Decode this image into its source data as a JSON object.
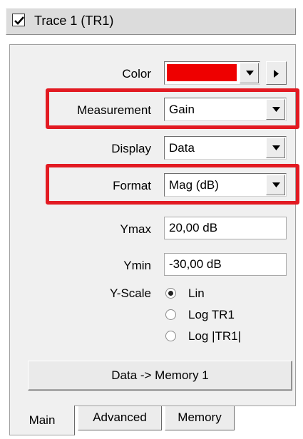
{
  "trace": {
    "title": "Trace 1 (TR1)",
    "enabled": true
  },
  "fields": {
    "color_label": "Color",
    "color_value": "#ee0000",
    "measurement_label": "Measurement",
    "measurement_value": "Gain",
    "display_label": "Display",
    "display_value": "Data",
    "format_label": "Format",
    "format_value": "Mag (dB)",
    "ymax_label": "Ymax",
    "ymax_value": "20,00 dB",
    "ymin_label": "Ymin",
    "ymin_value": "-30,00 dB"
  },
  "yscale": {
    "label": "Y-Scale",
    "options": [
      "Lin",
      "Log TR1",
      "Log |TR1|"
    ],
    "selected": "Lin"
  },
  "buttons": {
    "data_to_memory": "Data -> Memory 1"
  },
  "tabs": [
    "Main",
    "Advanced",
    "Memory"
  ],
  "active_tab": "Main",
  "highlight_color": "#e21a22"
}
